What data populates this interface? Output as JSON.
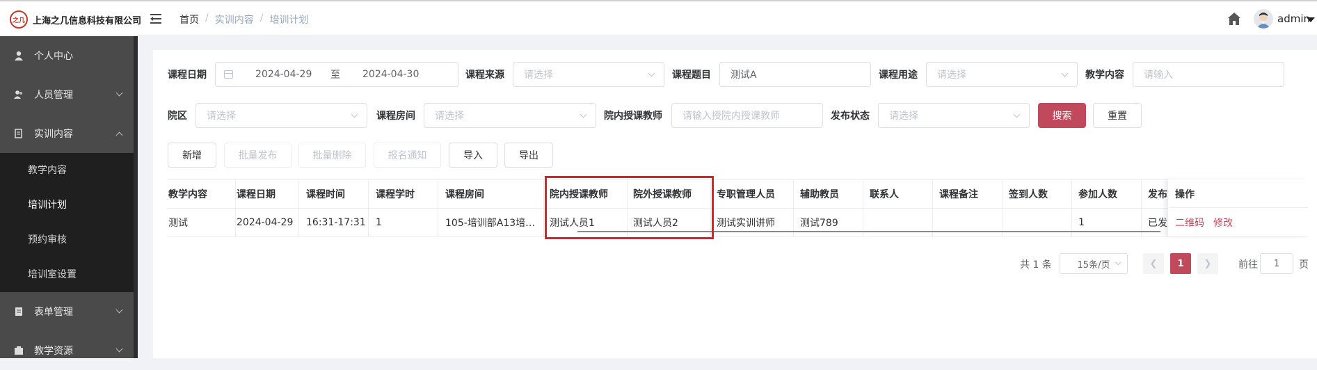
{
  "header": {
    "company": "上海之几信息科技有限公司",
    "logo_mark": "之几",
    "breadcrumb": [
      "首页",
      "实训内容",
      "培训计划"
    ],
    "breadcrumb_sep": "/",
    "username": "admin"
  },
  "sidebar": {
    "items": [
      {
        "label": "个人中心",
        "icon": "user-icon"
      },
      {
        "label": "人员管理",
        "icon": "users-icon"
      },
      {
        "label": "实训内容",
        "icon": "book-icon"
      },
      {
        "label": "表单管理",
        "icon": "form-icon"
      },
      {
        "label": "教学资源",
        "icon": "resource-icon"
      }
    ],
    "submenu": [
      "教学内容",
      "培训计划",
      "预约审核",
      "培训室设置"
    ],
    "active_sub": "培训计划"
  },
  "filters": {
    "course_date_label": "课程日期",
    "date_start": "2024-04-29",
    "date_to": "至",
    "date_end": "2024-04-30",
    "course_source_label": "课程来源",
    "course_source_ph": "请选择",
    "course_title_label": "课程题目",
    "course_title_value": "测试A",
    "course_use_label": "课程用途",
    "course_use_ph": "请选择",
    "teaching_content_label": "教学内容",
    "teaching_content_ph": "请输入",
    "campus_label": "院区",
    "campus_ph": "请选择",
    "room_label": "课程房间",
    "room_ph": "请选择",
    "inner_teacher_label": "院内授课教师",
    "inner_teacher_ph": "请输入授院内授课教师",
    "publish_label": "发布状态",
    "publish_ph": "请选择",
    "search_btn": "搜索",
    "reset_btn": "重置"
  },
  "actions": {
    "add": "新增",
    "batch_publish": "批量发布",
    "batch_delete": "批量删除",
    "signup_notice": "报名通知",
    "import": "导入",
    "export": "导出"
  },
  "table": {
    "headers": [
      "教学内容",
      "课程日期",
      "课程时间",
      "课程学时",
      "课程房间",
      "院内授课教师",
      "院外授课教师",
      "专职管理人员",
      "辅助教员",
      "联系人",
      "课程备注",
      "签到人数",
      "参加人数",
      "发布"
    ],
    "rows": [
      [
        "测试",
        "2024-04-29",
        "16:31-17:31",
        "1",
        "105-培训部A13培…",
        "测试人员1",
        "测试人员2",
        "测试实训讲师",
        "测试789",
        "",
        "",
        "",
        "1",
        "已发"
      ]
    ],
    "op_header": "操作",
    "op_links": [
      "二维码",
      "修改"
    ]
  },
  "pagination": {
    "total": "共 1 条",
    "page_size": "15条/页",
    "current_page": "1",
    "goto_label": "前往",
    "goto_value": "1",
    "page_unit": "页"
  },
  "colors": {
    "accent": "#c0495b",
    "highlight": "#e02020",
    "sidebar_bg": "#4a4a4a"
  }
}
